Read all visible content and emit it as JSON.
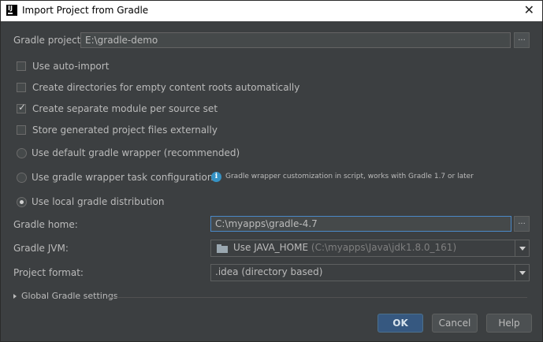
{
  "window": {
    "title": "Import Project from Gradle"
  },
  "gradle_project": {
    "label": "Gradle project:",
    "value": "E:\\gradle-demo",
    "browse": "..."
  },
  "options": {
    "auto_import": {
      "label": "Use auto-import",
      "checked": false
    },
    "create_dirs": {
      "label": "Create directories for empty content roots automatically",
      "checked": false
    },
    "separate_module": {
      "label": "Create separate module per source set",
      "checked": true
    },
    "store_externally": {
      "label": "Store generated project files externally",
      "checked": false
    }
  },
  "distribution": {
    "default_wrapper": {
      "label": "Use default gradle wrapper (recommended)",
      "selected": false
    },
    "wrapper_task": {
      "label": "Use gradle wrapper task configuration",
      "selected": false
    },
    "wrapper_info": "Gradle wrapper customization in script, works with Gradle 1.7 or later",
    "local": {
      "label": "Use local gradle distribution",
      "selected": true
    }
  },
  "gradle_home": {
    "label": "Gradle home:",
    "value": "C:\\myapps\\gradle-4.7",
    "browse": "..."
  },
  "gradle_jvm": {
    "label": "Gradle JVM:",
    "value": "Use JAVA_HOME",
    "path": "(C:\\myapps\\Java\\jdk1.8.0_161)"
  },
  "project_format": {
    "label": "Project format:",
    "value": ".idea (directory based)"
  },
  "global_settings": {
    "label": "Global Gradle settings"
  },
  "buttons": {
    "ok": "OK",
    "cancel": "Cancel",
    "help": "Help"
  },
  "colors": {
    "background": "#3c3f41",
    "accent": "#365880",
    "focus": "#4a88c7",
    "text": "#bbbbbb"
  }
}
